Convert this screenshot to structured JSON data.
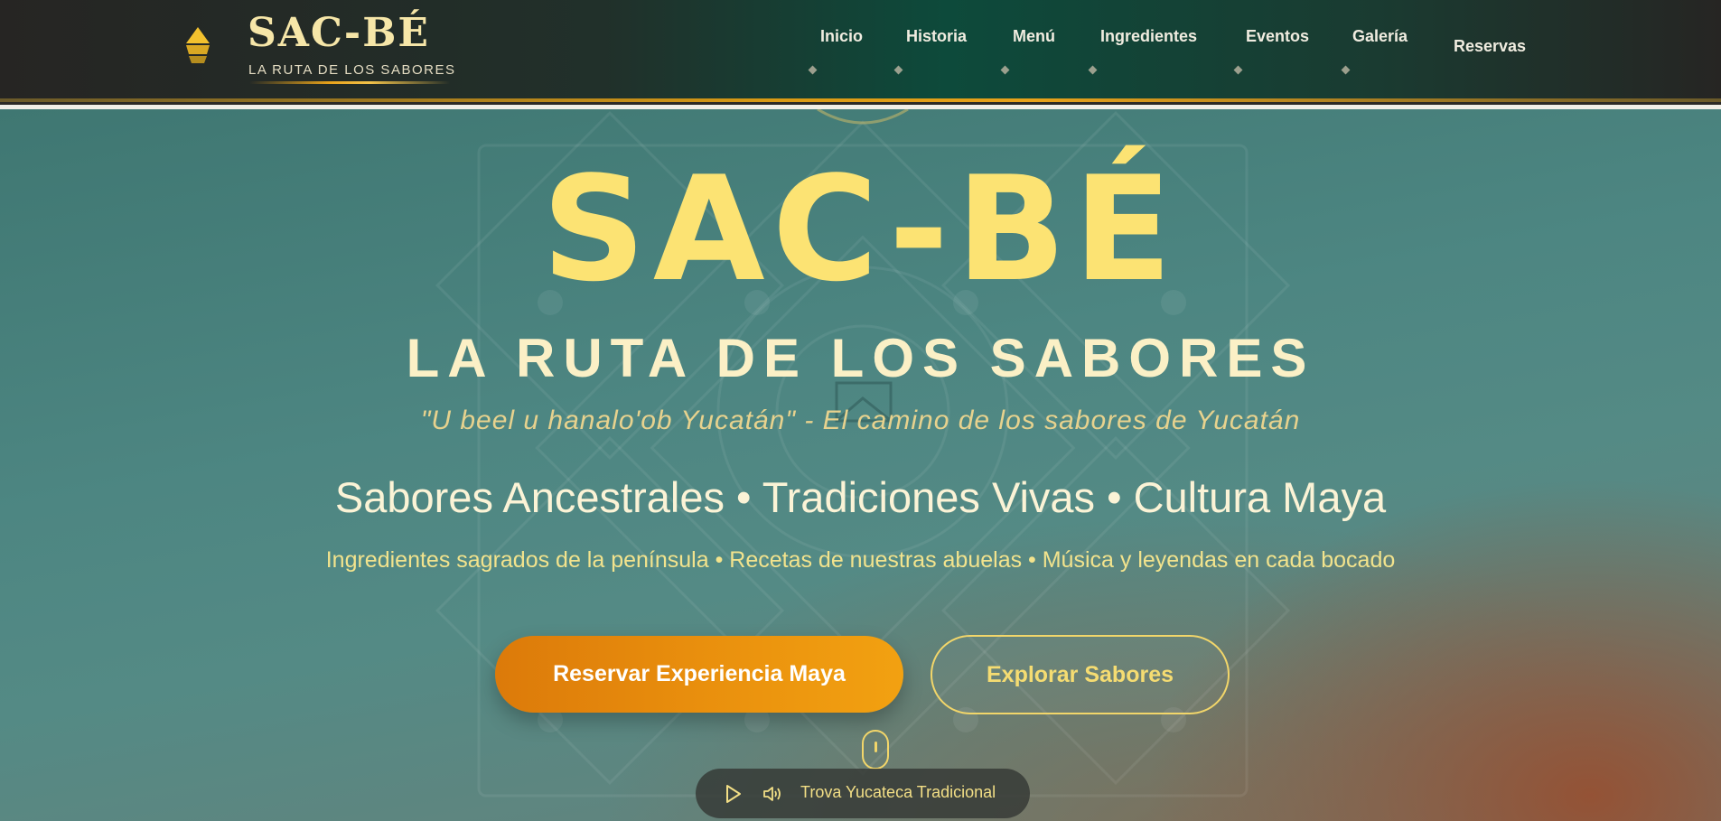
{
  "brand": {
    "title": "SAC-BÉ",
    "subtitle": "LA RUTA DE LOS SABORES",
    "logo_icon": "pyramid-icon"
  },
  "nav": {
    "items": [
      {
        "label": "Inicio"
      },
      {
        "label": "Historia"
      },
      {
        "label": "Menú"
      },
      {
        "label": "Ingredientes"
      },
      {
        "label": "Eventos"
      },
      {
        "label": "Galería"
      },
      {
        "label": "Reservas"
      }
    ]
  },
  "hero": {
    "title": "SAC-BÉ",
    "subtitle": "LA RUTA DE LOS SABORES",
    "quote": "\"U beel u hanalo'ob Yucatán\" - El camino de los sabores de Yucatán",
    "tagline": "Sabores Ancestrales • Tradiciones Vivas • Cultura Maya",
    "details": "Ingredientes sagrados de la península • Recetas de nuestras abuelas • Música y leyendas en cada bocado",
    "primary_button": "Reservar Experiencia Maya",
    "secondary_button": "Explorar Sabores"
  },
  "music": {
    "track": "Trova Yucateca Tradicional",
    "play_icon": "play-icon",
    "volume_icon": "volume-icon"
  },
  "colors": {
    "gold": "#fce373",
    "orange": "#e98f0d",
    "teal": "#4d8682",
    "nav_green": "#0d4a3b"
  }
}
